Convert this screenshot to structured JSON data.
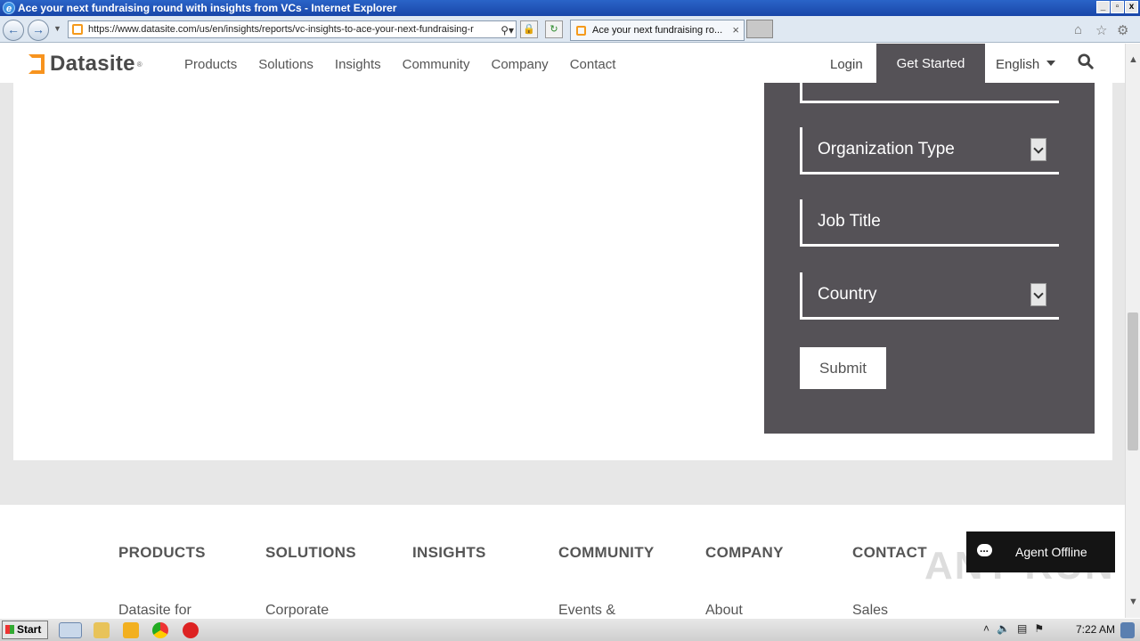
{
  "window": {
    "title": "Ace your next fundraising round with insights from VCs - Internet Explorer",
    "controls": [
      "_",
      "▫",
      "x"
    ]
  },
  "browser": {
    "url": "https://www.datasite.com/us/en/insights/reports/vc-insights-to-ace-your-next-fundraising-r",
    "tab_title": "Ace your next fundraising ro..."
  },
  "site": {
    "logo": "Datasite",
    "logo_mark": "®",
    "nav": [
      "Products",
      "Solutions",
      "Insights",
      "Community",
      "Company",
      "Contact"
    ],
    "login": "Login",
    "get_started": "Get Started",
    "language": "English"
  },
  "form": {
    "fields": {
      "org_type": "Organization Type",
      "job_title": "Job Title",
      "country": "Country"
    },
    "submit": "Submit"
  },
  "footer": {
    "columns": [
      {
        "heading": "PRODUCTS",
        "first_link": "Datasite for"
      },
      {
        "heading": "SOLUTIONS",
        "first_link": "Corporate"
      },
      {
        "heading": "INSIGHTS",
        "first_link": ""
      },
      {
        "heading": "COMMUNITY",
        "first_link": "Events &"
      },
      {
        "heading": "COMPANY",
        "first_link": "About"
      },
      {
        "heading": "CONTACT",
        "first_link": "Sales"
      }
    ]
  },
  "chat": {
    "label": "Agent Offline"
  },
  "watermark": "ANY RUN",
  "taskbar": {
    "start": "Start",
    "time": "7:22 AM"
  },
  "colors": {
    "panel": "#555257",
    "brand_orange": "#f7931e"
  }
}
